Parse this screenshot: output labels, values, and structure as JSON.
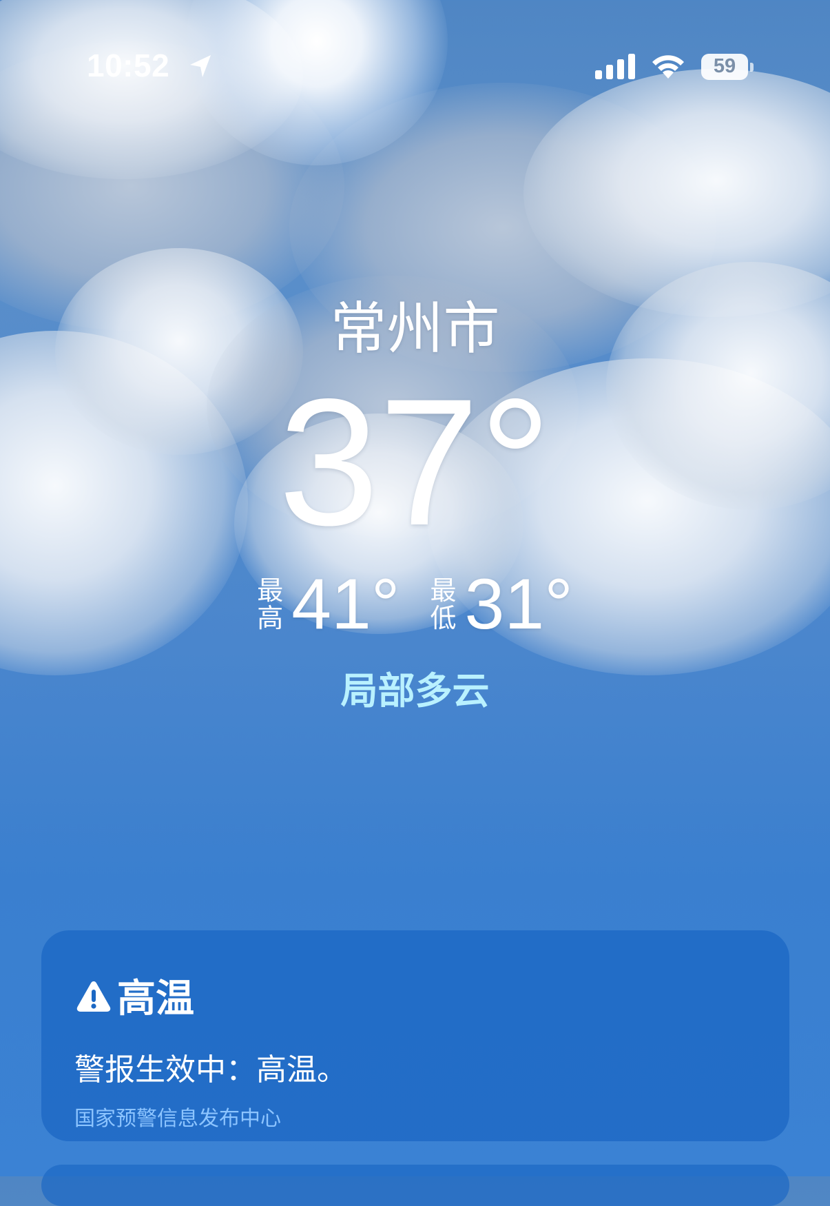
{
  "status_bar": {
    "time": "10:52",
    "battery_level": "59",
    "icons": [
      "location-arrow-icon",
      "signal-icon",
      "wifi-icon",
      "battery-icon"
    ]
  },
  "weather": {
    "city": "常州市",
    "temperature": "37°",
    "high_label_line1": "最",
    "high_label_line2": "高",
    "high_value": "41°",
    "low_label_line1": "最",
    "low_label_line2": "低",
    "low_value": "31°",
    "condition": "局部多云"
  },
  "alert": {
    "icon": "warning-icon",
    "title": "高温",
    "body": "警报生效中：高温。",
    "source": "国家预警信息发布中心"
  },
  "colors": {
    "condition_text": "#b9f1ff",
    "alert_card": "#1c68c4",
    "alert_source": "#8cc4ff"
  }
}
